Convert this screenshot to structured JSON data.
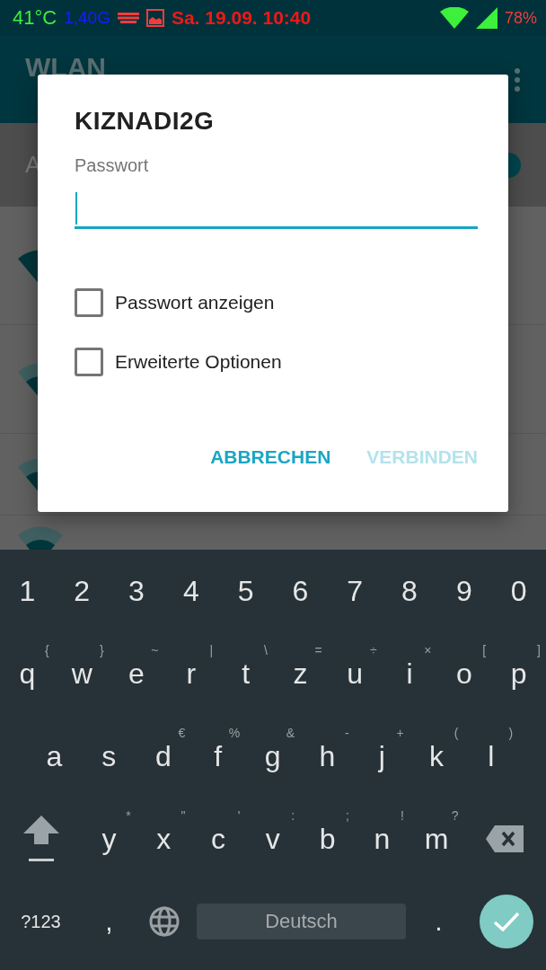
{
  "status_bar": {
    "temperature": "41°C",
    "memory": "1,40G",
    "datetime": "Sa. 19.09. 10:40",
    "battery": "78%"
  },
  "background": {
    "app_bar_title": "WLAN",
    "switch_label": "A",
    "switch_on": true,
    "networks": [
      {
        "kind": "full"
      },
      {
        "kind": "partial"
      },
      {
        "kind": "partial"
      },
      {
        "kind": "partial"
      }
    ]
  },
  "dialog": {
    "title": "KIZNADI2G",
    "field": {
      "label": "Passwort",
      "focused": true
    },
    "checkboxes": [
      {
        "label": "Passwort anzeigen",
        "checked": false
      },
      {
        "label": "Erweiterte Optionen",
        "checked": false
      }
    ],
    "buttons": [
      {
        "label": "ABBRECHEN",
        "disabled": false
      },
      {
        "label": "VERBINDEN",
        "disabled": true
      }
    ]
  },
  "keyboard": {
    "number_row": [
      "1",
      "2",
      "3",
      "4",
      "5",
      "6",
      "7",
      "8",
      "9",
      "0"
    ],
    "rows": [
      [
        {
          "key": "q",
          "hint": "{"
        },
        {
          "key": "w",
          "hint": "}"
        },
        {
          "key": "e",
          "hint": "~"
        },
        {
          "key": "r",
          "hint": "|"
        },
        {
          "key": "t",
          "hint": "\\"
        },
        {
          "key": "z",
          "hint": "="
        },
        {
          "key": "u",
          "hint": "÷"
        },
        {
          "key": "i",
          "hint": "×"
        },
        {
          "key": "o",
          "hint": "["
        },
        {
          "key": "p",
          "hint": "]"
        }
      ],
      [
        {
          "key": "a"
        },
        {
          "key": "s"
        },
        {
          "key": "d",
          "hint": "€"
        },
        {
          "key": "f",
          "hint": "%"
        },
        {
          "key": "g",
          "hint": "&"
        },
        {
          "key": "h",
          "hint": "-"
        },
        {
          "key": "j",
          "hint": "+"
        },
        {
          "key": "k",
          "hint": "("
        },
        {
          "key": "l",
          "hint": ")"
        }
      ],
      [
        {
          "key": "y",
          "hint": "*"
        },
        {
          "key": "x",
          "hint": "\""
        },
        {
          "key": "c",
          "hint": "'"
        },
        {
          "key": "v",
          "hint": ":"
        },
        {
          "key": "b",
          "hint": ";"
        },
        {
          "key": "n",
          "hint": "!"
        },
        {
          "key": "m",
          "hint": "?"
        }
      ]
    ],
    "mode_key": "?123",
    "comma": ",",
    "space": "Deutsch",
    "period": "."
  }
}
